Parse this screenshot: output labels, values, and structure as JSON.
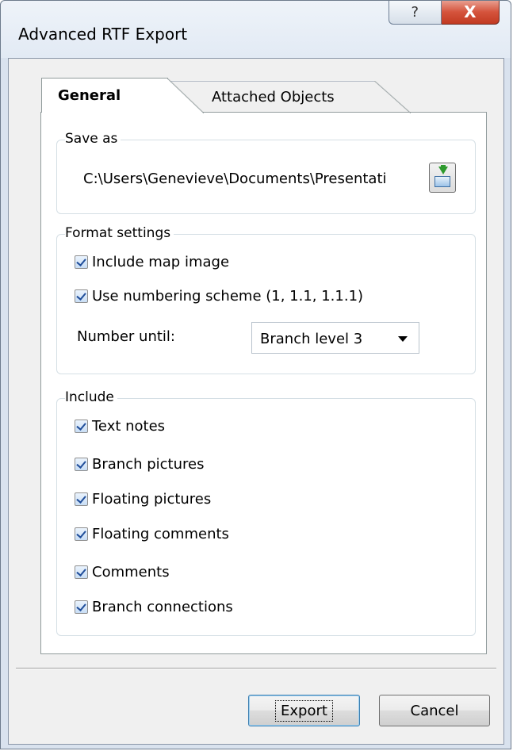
{
  "window": {
    "title": "Advanced RTF Export",
    "help_glyph": "?",
    "close_glyph": "X"
  },
  "tabs": [
    {
      "label": "General",
      "selected": true
    },
    {
      "label": "Attached Objects",
      "selected": false
    }
  ],
  "save_as": {
    "group_label": "Save as",
    "path_value": "C:\\Users\\Genevieve\\Documents\\Presentati",
    "browse_icon": "export-folder-icon"
  },
  "format_settings": {
    "group_label": "Format settings",
    "include_map_image": {
      "label": "Include map image",
      "checked": true
    },
    "use_numbering": {
      "label": "Use numbering scheme (1, 1.1, 1.1.1)",
      "checked": true
    },
    "number_until_label": "Number until:",
    "number_until_value": "Branch level 3"
  },
  "include": {
    "group_label": "Include",
    "items": [
      {
        "label": "Text notes",
        "checked": true
      },
      {
        "label": "Branch pictures",
        "checked": true
      },
      {
        "label": "Floating pictures",
        "checked": true
      },
      {
        "label": "Floating comments",
        "checked": true
      },
      {
        "label": "Comments",
        "checked": true
      },
      {
        "label": "Branch connections",
        "checked": true
      }
    ]
  },
  "buttons": {
    "export": "Export",
    "cancel": "Cancel"
  }
}
